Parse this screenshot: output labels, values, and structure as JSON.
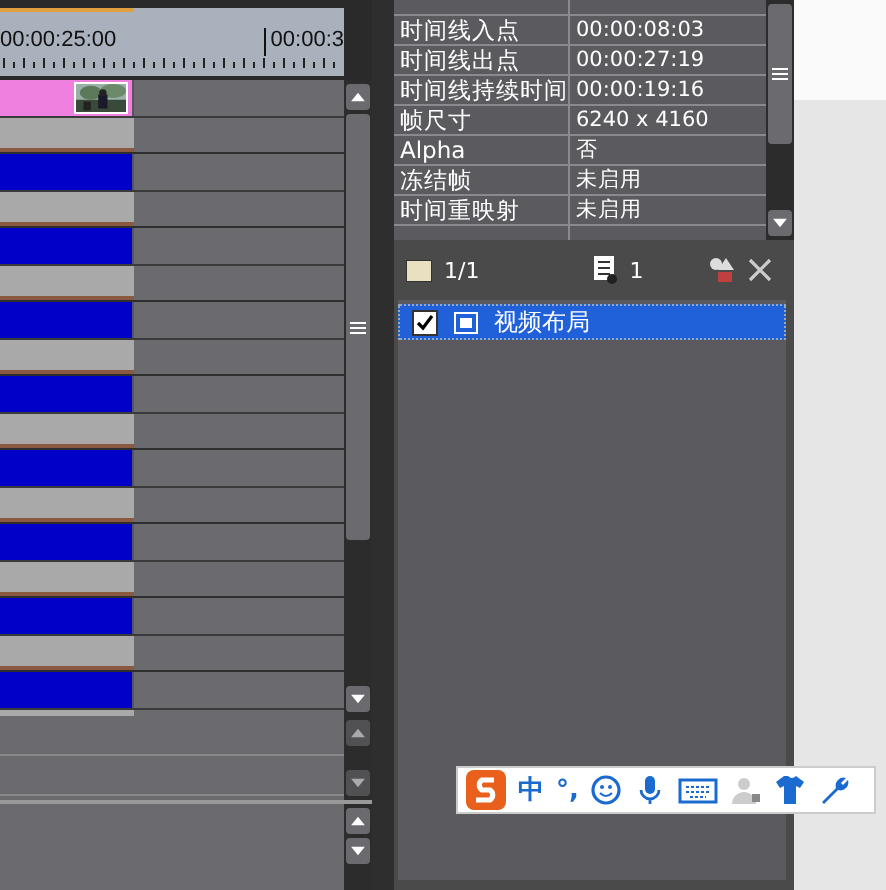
{
  "timeline": {
    "ruler_labels": [
      "00:00:25:00",
      "00:00:3"
    ],
    "tracks": [
      {
        "color": "#f080e0",
        "thumbnail": true
      },
      {
        "color": "#0000c8",
        "thumbnail": false
      },
      {
        "color": "#0000c8",
        "thumbnail": false
      },
      {
        "color": "#0000c8",
        "thumbnail": false
      },
      {
        "color": "#0000c8",
        "thumbnail": false
      },
      {
        "color": "#0000c8",
        "thumbnail": false
      },
      {
        "color": "#0000c8",
        "thumbnail": false
      },
      {
        "color": "#0000c8",
        "thumbnail": false
      },
      {
        "color": "#0000c8",
        "thumbnail": false
      }
    ]
  },
  "info_table": {
    "rows": [
      {
        "name": "时间线入点",
        "value": "00:00:08:03"
      },
      {
        "name": "时间线出点",
        "value": "00:00:27:19"
      },
      {
        "name": "时间线持续时间",
        "value": "00:00:19:16"
      },
      {
        "name": "帧尺寸",
        "value": "6240 x 4160"
      },
      {
        "name": "Alpha",
        "value": "否"
      },
      {
        "name": "冻结帧",
        "value": "未启用"
      },
      {
        "name": "时间重映射",
        "value": "未启用"
      }
    ]
  },
  "effects_toolbar": {
    "page": "1/1",
    "count": "1"
  },
  "effects_list": [
    {
      "label": "视频布局",
      "checked": true,
      "selected": true
    }
  ],
  "ime_toolbar": {
    "mode": "中",
    "punctuation": "°,"
  }
}
